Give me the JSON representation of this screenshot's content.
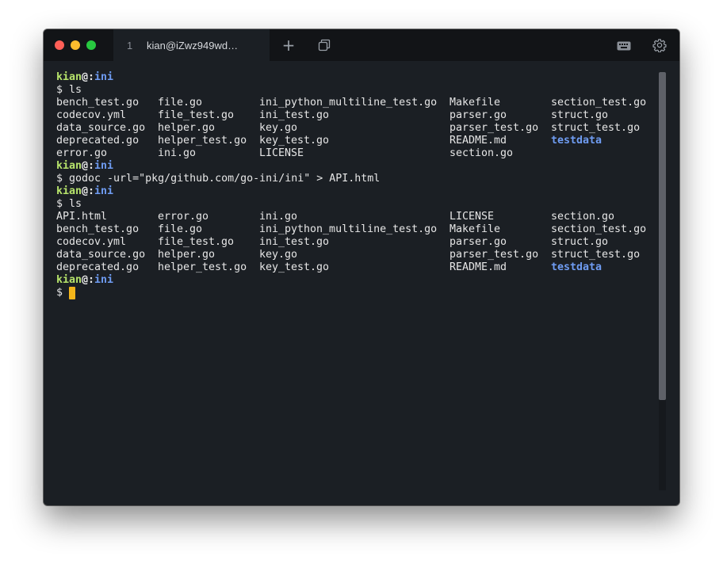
{
  "tab": {
    "index": "1",
    "title": "kian@iZwz949wd…"
  },
  "toolbar": {
    "new_tab_glyph": "+"
  },
  "icons": {
    "new_tab": "plus-icon",
    "tabs_overview": "tabs-overview-icon",
    "keyboard": "keyboard-icon",
    "settings": "gear-icon"
  },
  "colors": {
    "cursor": "#f3b51a",
    "user": "#b6e36b",
    "directory": "#6f9cf2",
    "background": "#1b1f24"
  },
  "terminal": {
    "prompt_user": "kian",
    "prompt_at": "@:",
    "prompt_dir": "ini",
    "commands": [
      "$ ls",
      "$ godoc -url=\"pkg/github.com/go-ini/ini\" > API.html",
      "$ ls",
      "$ "
    ],
    "listing1": [
      [
        "bench_test.go",
        "file.go",
        "ini_python_multiline_test.go",
        "Makefile",
        "section_test.go"
      ],
      [
        "codecov.yml",
        "file_test.go",
        "ini_test.go",
        "parser.go",
        "struct.go"
      ],
      [
        "data_source.go",
        "helper.go",
        "key.go",
        "parser_test.go",
        "struct_test.go"
      ],
      [
        "deprecated.go",
        "helper_test.go",
        "key_test.go",
        "README.md",
        "testdata"
      ],
      [
        "error.go",
        "ini.go",
        "LICENSE",
        "section.go",
        ""
      ]
    ],
    "listing2": [
      [
        "API.html",
        "error.go",
        "ini.go",
        "LICENSE",
        "section.go"
      ],
      [
        "bench_test.go",
        "file.go",
        "ini_python_multiline_test.go",
        "Makefile",
        "section_test.go"
      ],
      [
        "codecov.yml",
        "file_test.go",
        "ini_test.go",
        "parser.go",
        "struct.go"
      ],
      [
        "data_source.go",
        "helper.go",
        "key.go",
        "parser_test.go",
        "struct_test.go"
      ],
      [
        "deprecated.go",
        "helper_test.go",
        "key_test.go",
        "README.md",
        "testdata"
      ]
    ],
    "directories": [
      "testdata"
    ]
  }
}
